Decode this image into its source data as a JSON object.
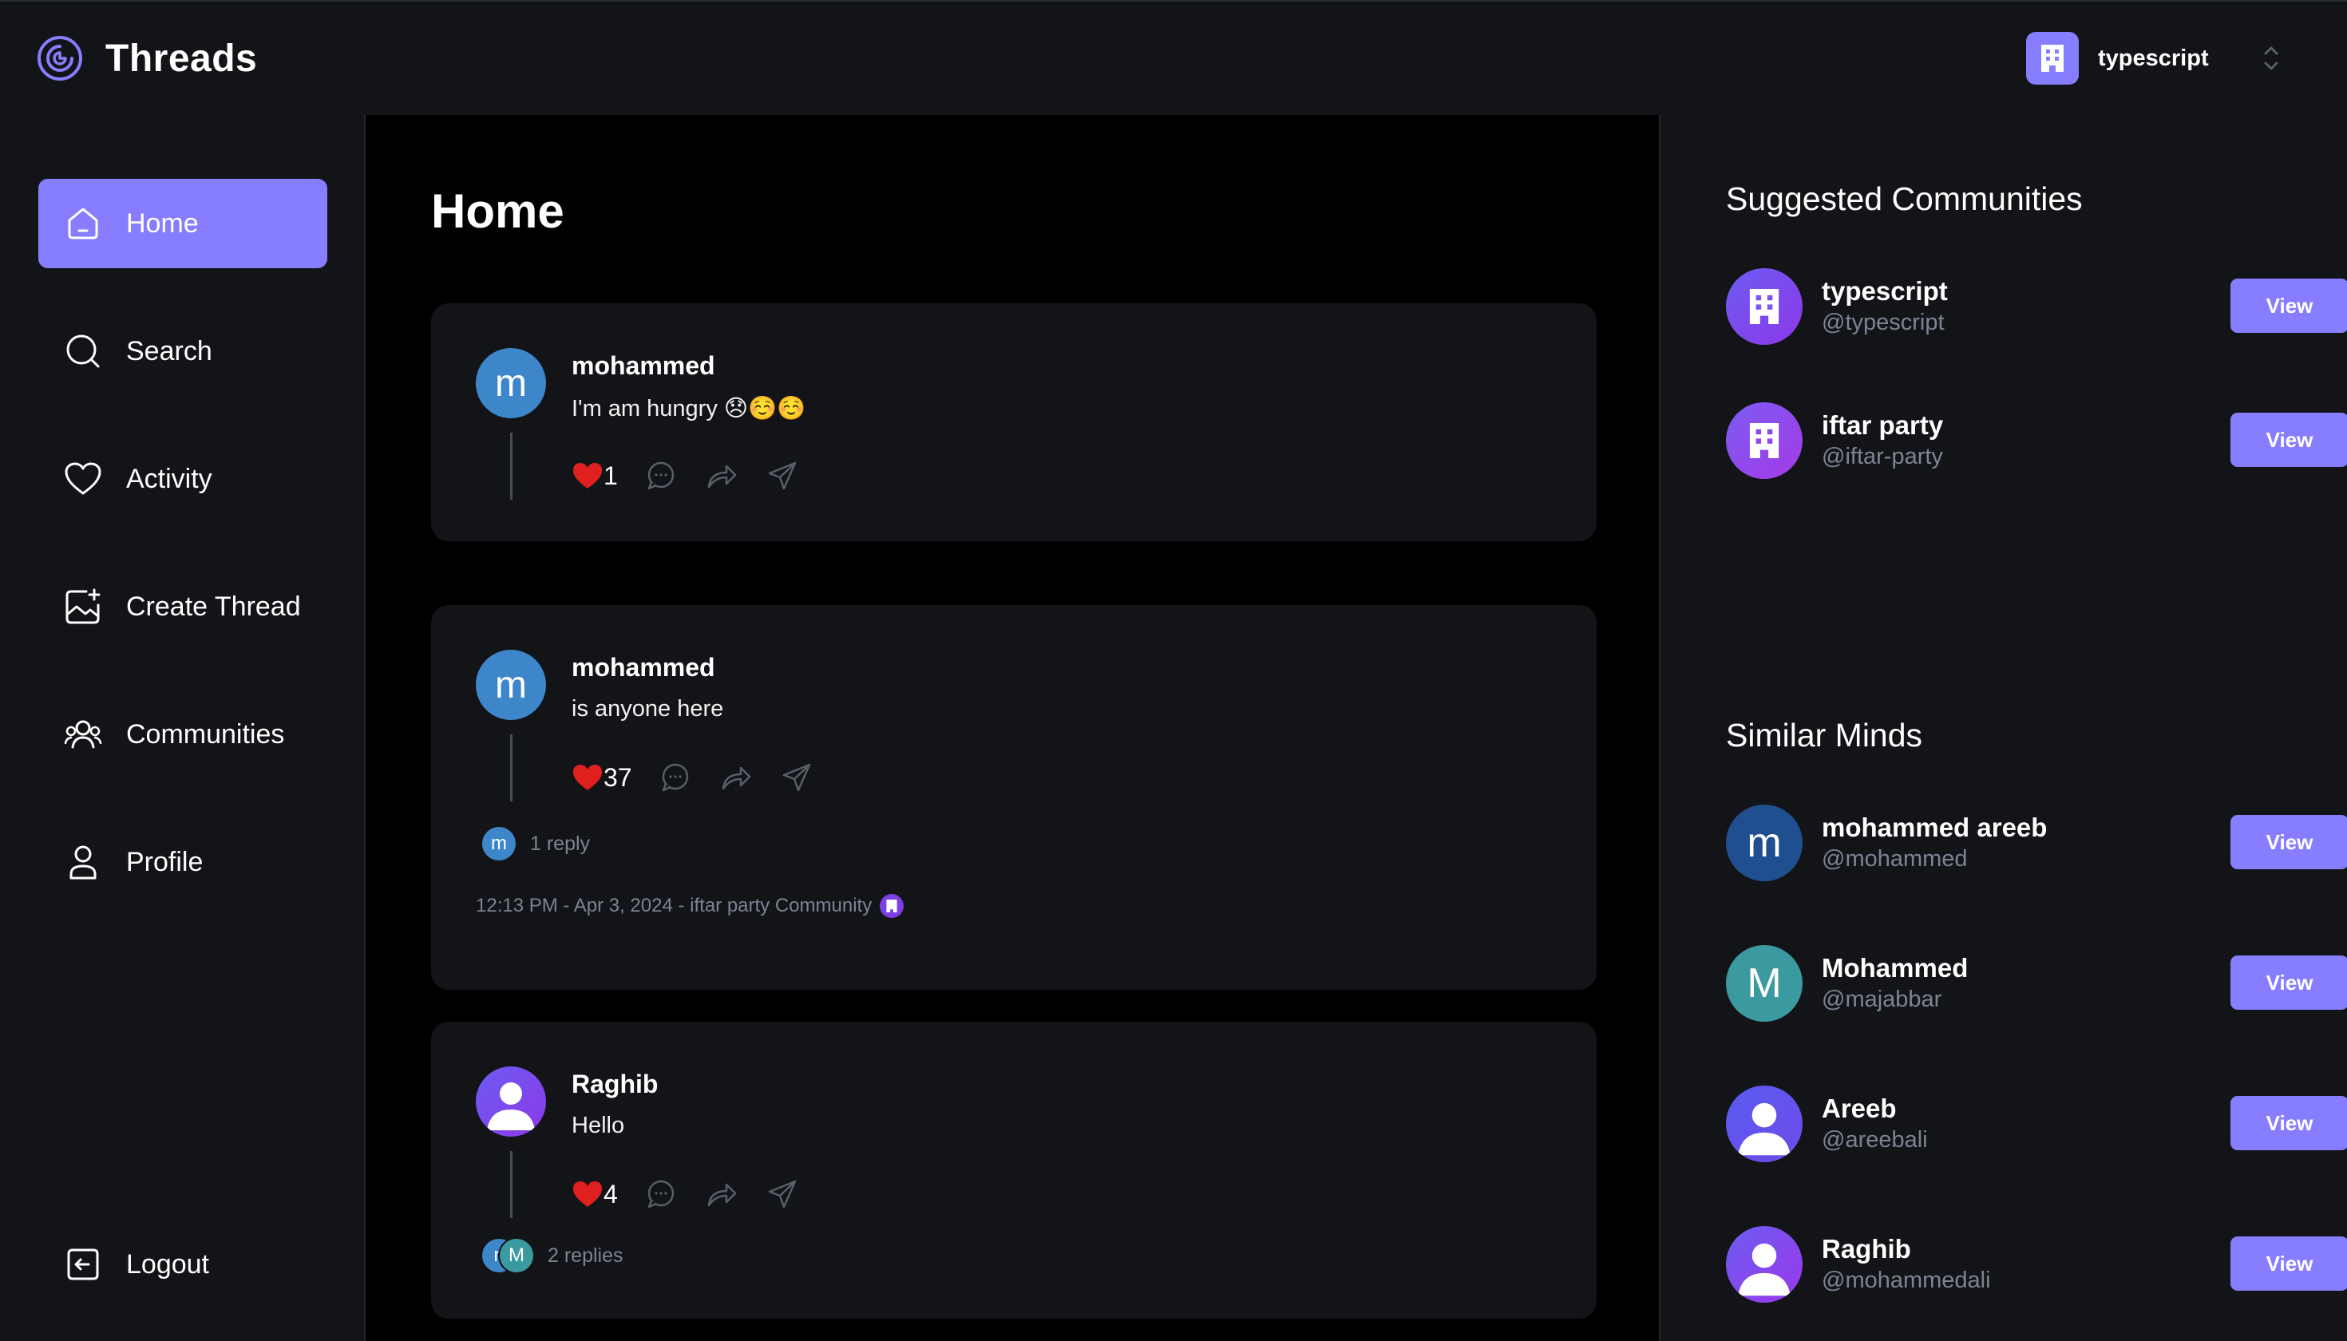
{
  "app": {
    "title": "Threads"
  },
  "org": {
    "name": "typescript"
  },
  "nav": [
    {
      "label": "Home",
      "icon": "home-icon",
      "active": true
    },
    {
      "label": "Search",
      "icon": "search-icon"
    },
    {
      "label": "Activity",
      "icon": "heart-icon"
    },
    {
      "label": "Create Thread",
      "icon": "image-plus-icon"
    },
    {
      "label": "Communities",
      "icon": "people-icon"
    },
    {
      "label": "Profile",
      "icon": "user-icon"
    }
  ],
  "logout": {
    "label": "Logout",
    "icon": "logout-icon"
  },
  "main": {
    "title": "Home",
    "posts": [
      {
        "author": "mohammed",
        "avatar_letter": "m",
        "avatar_color": "#3d86c9",
        "text": "I'm am hungry 😞☺️☺️",
        "likes": "1"
      },
      {
        "author": "mohammed",
        "avatar_letter": "m",
        "avatar_color": "#3d86c9",
        "text": "is anyone here",
        "likes": "37",
        "reply_avatar": "m",
        "replies": "1 reply",
        "meta": "12:13 PM - Apr 3, 2024 - iftar party Community"
      },
      {
        "author": "Raghib",
        "text": "Hello",
        "likes": "4",
        "reply_avatars": [
          "n",
          "M"
        ],
        "replies": "2 replies"
      }
    ]
  },
  "right": {
    "communities_title": "Suggested Communities",
    "communities": [
      {
        "name": "typescript",
        "handle": "@typescript",
        "button": "View"
      },
      {
        "name": "iftar party",
        "handle": "@iftar-party",
        "button": "View"
      }
    ],
    "minds_title": "Similar Minds",
    "minds": [
      {
        "name": "mohammed areeb",
        "handle": "@mohammed",
        "letter": "m",
        "color": "#1f4f8e",
        "button": "View"
      },
      {
        "name": "Mohammed",
        "handle": "@majabbar",
        "letter": "M",
        "color": "#3b9aa0",
        "button": "View"
      },
      {
        "name": "Areeb",
        "handle": "@areebali",
        "button": "View"
      },
      {
        "name": "Raghib",
        "handle": "@mohammedali",
        "button": "View"
      }
    ]
  },
  "colors": {
    "accent": "#877eff",
    "card": "#121417",
    "muted": "#7e8394",
    "like": "#e0201f"
  }
}
